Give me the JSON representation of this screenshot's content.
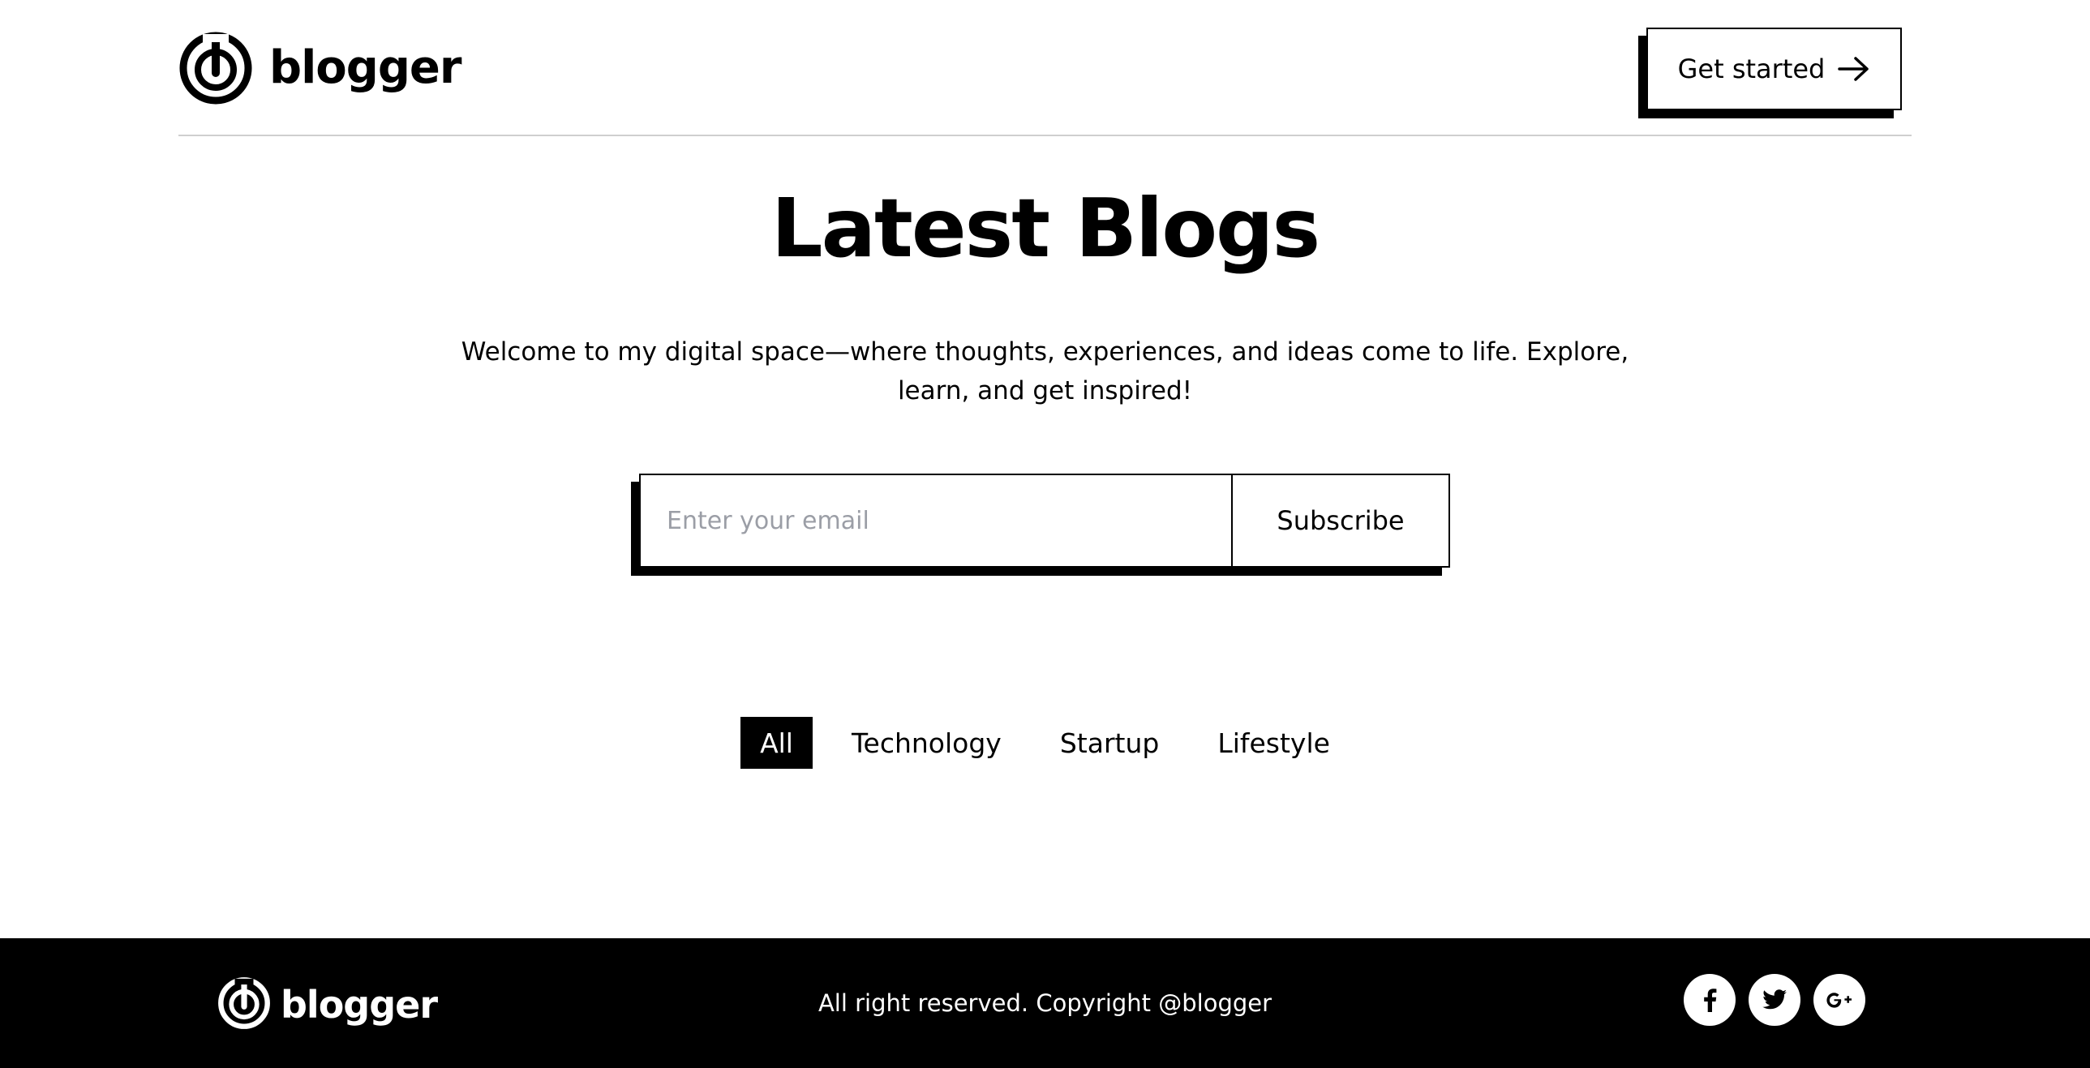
{
  "header": {
    "brand_name": "blogger",
    "cta_label": "Get started",
    "cta_icon": "arrow-right-icon"
  },
  "hero": {
    "title": "Latest Blogs",
    "subtitle": "Welcome to my digital space—where thoughts, experiences, and ideas come to life. Explore, learn, and get inspired!"
  },
  "subscribe": {
    "email_placeholder": "Enter your email",
    "email_value": "",
    "button_label": "Subscribe"
  },
  "filters": {
    "tabs": [
      {
        "label": "All",
        "active": true
      },
      {
        "label": "Technology",
        "active": false
      },
      {
        "label": "Startup",
        "active": false
      },
      {
        "label": "Lifestyle",
        "active": false
      }
    ]
  },
  "footer": {
    "brand_name": "blogger",
    "copyright": "All right reserved. Copyright @blogger",
    "social": [
      "facebook-icon",
      "twitter-icon",
      "google-plus-icon"
    ]
  },
  "colors": {
    "primary": "#000000",
    "background": "#ffffff",
    "placeholder": "#9b9ea6",
    "divider": "#cfcfcf"
  }
}
